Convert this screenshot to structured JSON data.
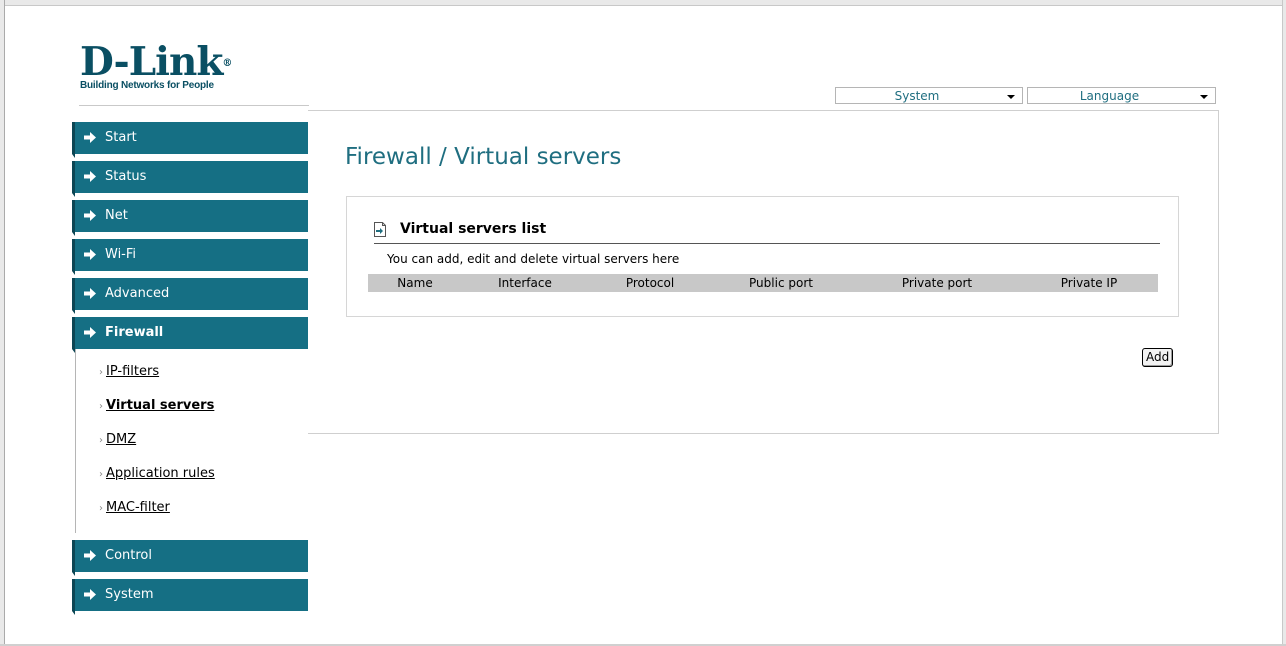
{
  "logo": {
    "brand": "D-Link",
    "registered": "®",
    "tagline": "Building Networks for People"
  },
  "top_menu": {
    "system": "System",
    "language": "Language"
  },
  "sidebar": {
    "items_top": [
      {
        "label": "Start",
        "icon": "arrow-right-icon"
      },
      {
        "label": "Status",
        "icon": "arrow-right-icon"
      },
      {
        "label": "Net",
        "icon": "arrow-right-icon"
      },
      {
        "label": "Wi-Fi",
        "icon": "arrow-right-icon"
      },
      {
        "label": "Advanced",
        "icon": "arrow-right-icon"
      },
      {
        "label": "Firewall",
        "icon": "arrow-right-icon",
        "active": true
      }
    ],
    "firewall_submenu": [
      {
        "label": "IP-filters"
      },
      {
        "label": "Virtual servers",
        "active": true
      },
      {
        "label": "DMZ"
      },
      {
        "label": "Application rules"
      },
      {
        "label": "MAC-filter"
      }
    ],
    "items_bottom": [
      {
        "label": "Control",
        "icon": "arrow-right-icon"
      },
      {
        "label": "System",
        "icon": "arrow-right-icon"
      }
    ]
  },
  "main": {
    "title": "Firewall /  Virtual servers",
    "panel": {
      "title": "Virtual servers list",
      "description": "You can add, edit and delete virtual servers here",
      "columns": [
        "Name",
        "Interface",
        "Protocol",
        "Public port",
        "Private port",
        "Private IP"
      ]
    },
    "add_button": "Add"
  },
  "colors": {
    "nav_bg": "#156f84",
    "accent_text": "#1f6e80",
    "logo": "#0a4f63"
  }
}
